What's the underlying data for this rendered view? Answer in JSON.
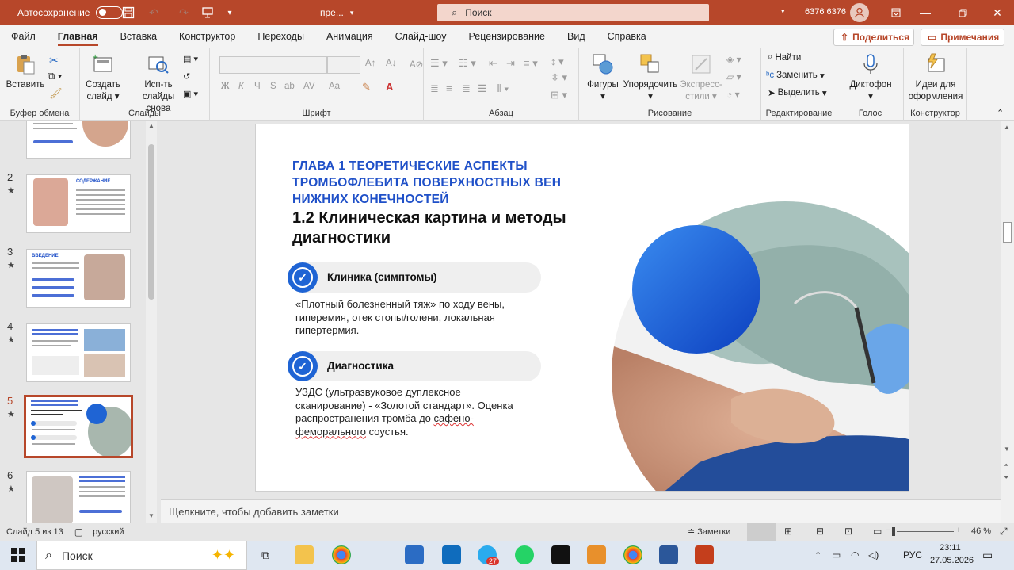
{
  "titlebar": {
    "autosave_label": "Автосохранение",
    "filename": "пре...",
    "search_placeholder": "Поиск",
    "user": "6376 6376"
  },
  "menu": {
    "items": [
      "Файл",
      "Главная",
      "Вставка",
      "Конструктор",
      "Переходы",
      "Анимация",
      "Слайд-шоу",
      "Рецензирование",
      "Вид",
      "Справка"
    ],
    "share": "Поделиться",
    "comments": "Примечания"
  },
  "ribbon": {
    "paste": "Вставить",
    "clipboard_group": "Буфер обмена",
    "new_slide": [
      "Создать",
      "слайд"
    ],
    "reuse": [
      "Исп-ть",
      "слайды снова"
    ],
    "slides_group": "Слайды",
    "font_group": "Шрифт",
    "font_buttons": [
      "Ж",
      "К",
      "Ч",
      "S",
      "ab",
      "AV",
      "Aa"
    ],
    "paragraph_group": "Абзац",
    "shapes": "Фигуры",
    "arrange": "Упорядочить",
    "quick_styles": [
      "Экспресс-",
      "стили"
    ],
    "drawing_group": "Рисование",
    "find": "Найти",
    "replace": "Заменить",
    "select": "Выделить",
    "editing_group": "Редактирование",
    "dictate": "Диктофон",
    "voice_group": "Голос",
    "designer": [
      "Идеи для",
      "оформления"
    ],
    "designer_group": "Конструктор"
  },
  "thumbnails": [
    {
      "num": "",
      "title": ""
    },
    {
      "num": "2",
      "title": "СОДЕРЖАНИЕ"
    },
    {
      "num": "3",
      "title": "ВВЕДЕНИЕ"
    },
    {
      "num": "4",
      "title": ""
    },
    {
      "num": "5",
      "title": ""
    },
    {
      "num": "6",
      "title": ""
    }
  ],
  "slide": {
    "heading_blue": "ГЛАВА 1 ТЕОРЕТИЧЕСКИЕ АСПЕКТЫ ТРОМБОФЛЕБИТА ПОВЕРХНОСТНЫХ ВЕН НИЖНИХ КОНЕЧНОСТЕЙ",
    "heading": "1.2 Клиническая картина и методы диагностики",
    "section1": {
      "title": "Клиника (симптомы)",
      "text": "«Плотный болезненный тяж» по ходу вены, гиперемия, отек стопы/голени, локальная гипертермия."
    },
    "section2": {
      "title": "Диагностика",
      "text_a": "УЗДС (ультразвуковое дуплексное сканирование) - «Золотой стандарт». Оценка распространения тромба до ",
      "text_b": "сафено-феморального",
      "text_c": " соустья."
    }
  },
  "notes_placeholder": "Щелкните, чтобы добавить заметки",
  "status": {
    "slide_counter": "Слайд 5 из 13",
    "language": "русский",
    "notes_btn": "Заметки",
    "zoom": "46 %"
  },
  "taskbar": {
    "search": "Поиск",
    "telegram_badge": "27",
    "lang": "РУС",
    "time": "23:11",
    "date": "27.05.2026"
  },
  "colors": {
    "accent": "#b7472a",
    "heading_blue": "#1f50c8",
    "icon_blue": "#1f64d4"
  }
}
